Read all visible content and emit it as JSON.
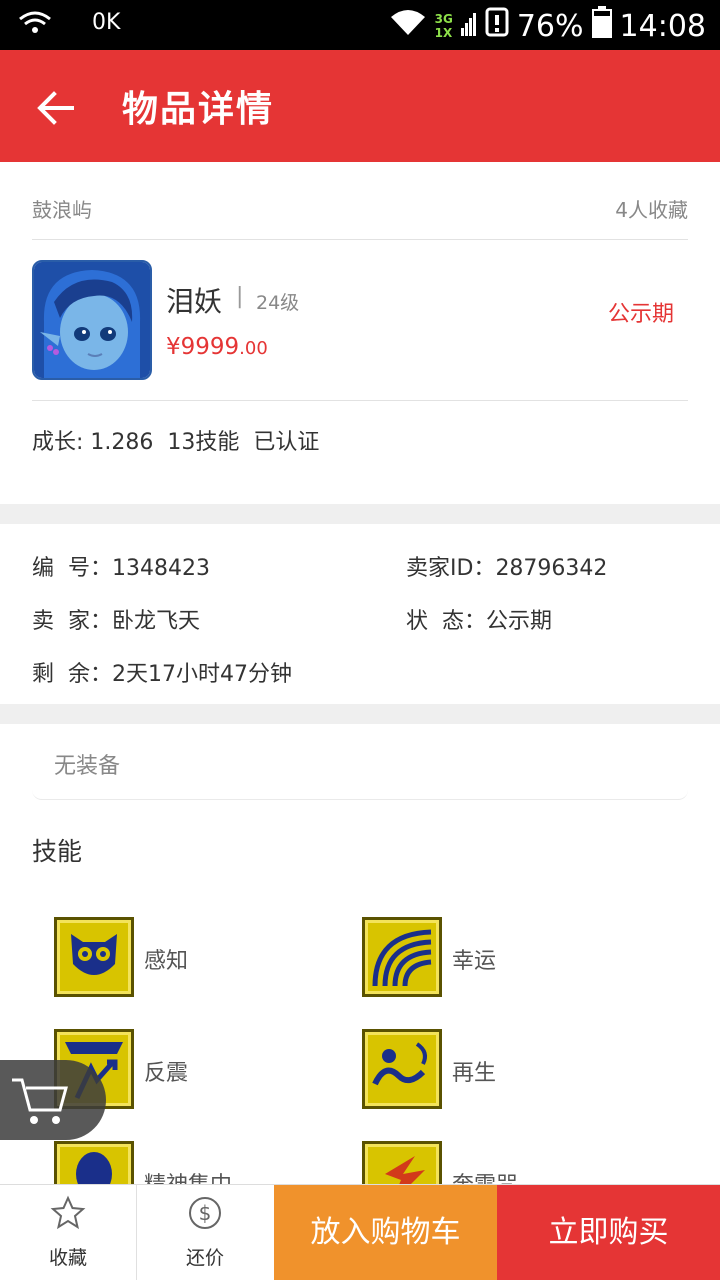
{
  "status_bar": {
    "carrier_text": "0K",
    "network_top": "3G",
    "network_bottom": "1X",
    "battery": "76%",
    "time": "14:08"
  },
  "app_bar": {
    "title": "物品详情",
    "back_icon": "arrow-left-icon"
  },
  "item": {
    "server": "鼓浪屿",
    "favorites": "4人收藏",
    "name": "泪妖",
    "separator": "|",
    "level": "24级",
    "price_main": "¥9999",
    "price_decimal": ".00",
    "phase": "公示期",
    "attributes": "成长: 1.286  13技能  已认证"
  },
  "details": {
    "id_label": "编  号：",
    "id_value": "1348423",
    "seller_id_label": "卖家ID：",
    "seller_id_value": "28796342",
    "seller_label": "卖  家：",
    "seller_value": "卧龙飞天",
    "status_label": "状  态：",
    "status_value": "公示期",
    "remain_label": "剩  余：",
    "remain_value": "2天17小时47分钟"
  },
  "equipment": {
    "empty_text": "无装备"
  },
  "skills": {
    "title": "技能",
    "items": [
      {
        "label": "感知",
        "icon": "owl-icon"
      },
      {
        "label": "幸运",
        "icon": "rainbow-icon"
      },
      {
        "label": "反震",
        "icon": "deflect-icon"
      },
      {
        "label": "再生",
        "icon": "regen-icon"
      },
      {
        "label": "精神集中",
        "icon": "focus-icon"
      },
      {
        "label": "奔雷咒",
        "icon": "thunder-icon"
      }
    ]
  },
  "bottom_bar": {
    "favorite_label": "收藏",
    "bargain_label": "还价",
    "add_cart_label": "放入购物车",
    "buy_label": "立即购买"
  },
  "colors": {
    "primary_red": "#e53535",
    "orange": "#f0922c",
    "skill_gold": "#d8c400"
  }
}
